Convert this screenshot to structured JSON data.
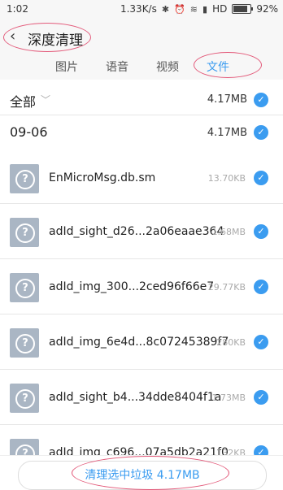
{
  "status": {
    "time": "1:02",
    "speed": "1.33K/s",
    "network": "HD",
    "battery": "92%"
  },
  "header": {
    "title": "深度清理"
  },
  "tabs": [
    "图片",
    "语音",
    "视频",
    "文件"
  ],
  "summary": {
    "label": "全部",
    "size": "4.17MB"
  },
  "group": {
    "label": "09-06",
    "size": "4.17MB"
  },
  "files": [
    {
      "name": "EnMicroMsg.db.sm",
      "size": "13.70KB"
    },
    {
      "name": "adId_sight_d26...2a06eaae364",
      "size": "1.68MB"
    },
    {
      "name": "adId_img_300...2ced96f66e7",
      "size": "29.77KB"
    },
    {
      "name": "adId_img_6e4d...8c07245389f7",
      "size": "280KB"
    },
    {
      "name": "adId_sight_b4...34dde8404f1a",
      "size": "1.73MB"
    },
    {
      "name": "adId_img_c696...07a5db2a21f0",
      "size": "132KB"
    }
  ],
  "footer": {
    "button_label": "清理选中垃圾 4.17MB"
  },
  "colors": {
    "accent": "#3b9cf0",
    "annotation": "#e35a7a"
  }
}
